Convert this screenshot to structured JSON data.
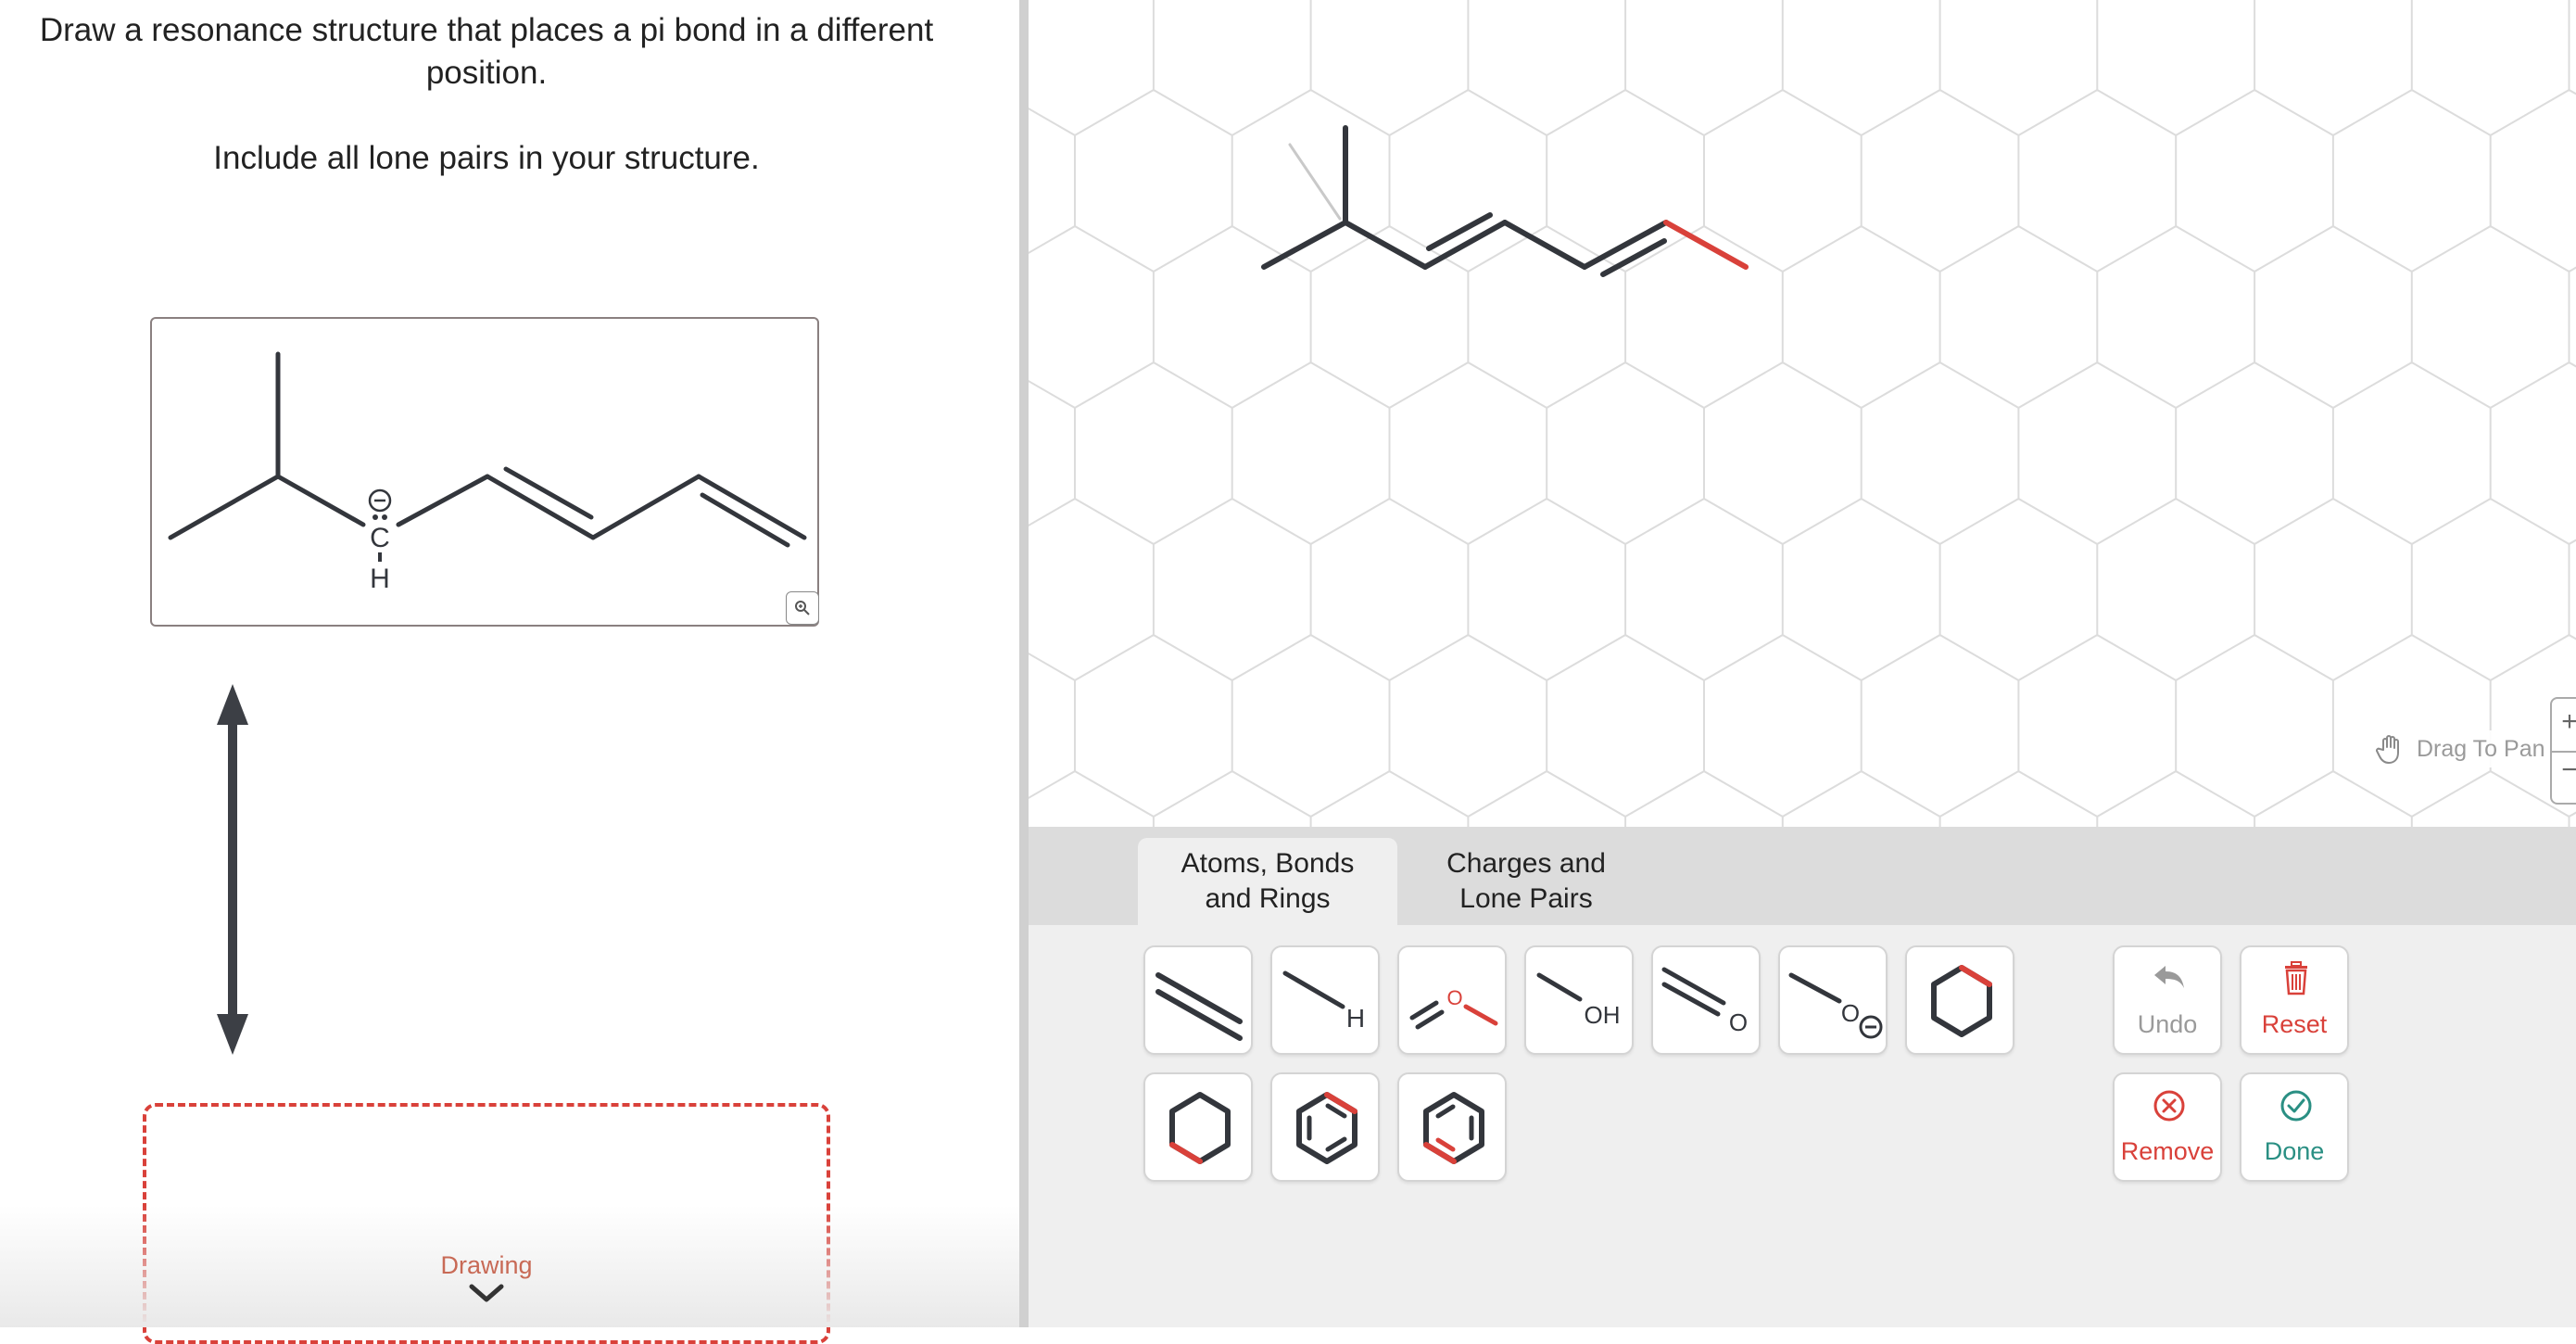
{
  "prompt": {
    "line1": "Draw a resonance structure that places a pi bond in a different position.",
    "line2": "Include all lone pairs in your structure."
  },
  "given_structure": {
    "atom_label": "C",
    "hydrogen_label": "H",
    "charge_symbol": "−"
  },
  "drawing": {
    "label": "Drawing"
  },
  "canvas": {
    "drag_to_pan": "Drag To Pan",
    "zoom_in": "+",
    "zoom_out": "−"
  },
  "tabs": [
    {
      "label_line1": "Atoms, Bonds",
      "label_line2": "and Rings",
      "selected": true
    },
    {
      "label_line1": "Charges and",
      "label_line2": "Lone Pairs",
      "selected": false
    }
  ],
  "tools": {
    "h_label": "H",
    "o_label": "O",
    "oh_label": "OH",
    "carbonyl_o_label": "O",
    "alkoxide_o_label": "O"
  },
  "actions": {
    "undo": "Undo",
    "reset": "Reset",
    "remove": "Remove",
    "done": "Done"
  },
  "colors": {
    "accent_red": "#d9413a",
    "done_teal": "#2a8f83",
    "bond_dark": "#33363c",
    "disabled_gray": "#9a9a9a"
  }
}
